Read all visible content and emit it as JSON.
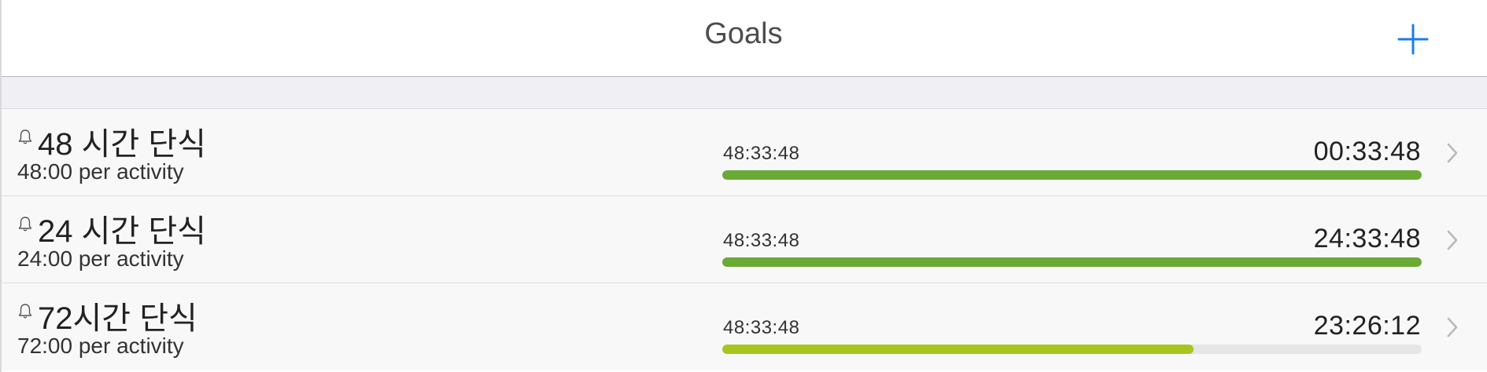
{
  "navbar": {
    "title": "Goals",
    "add_icon": "plus-icon",
    "accent_color": "#1a7fe8"
  },
  "goals": [
    {
      "title": "48 시간 단식",
      "subtitle": "48:00 per activity",
      "elapsed": "48:33:48",
      "remaining": "00:33:48",
      "progress": 1.0,
      "bar_color": "#6aaa35",
      "reminder_icon": "bell-icon"
    },
    {
      "title": "24 시간 단식",
      "subtitle": "24:00 per activity",
      "elapsed": "48:33:48",
      "remaining": "24:33:48",
      "progress": 1.0,
      "bar_color": "#6aaa35",
      "reminder_icon": "bell-icon"
    },
    {
      "title": "72시간 단식",
      "subtitle": "72:00 per activity",
      "elapsed": "48:33:48",
      "remaining": "23:26:12",
      "progress": 0.674,
      "bar_color": "#a6c61f",
      "reminder_icon": "bell-icon"
    }
  ]
}
